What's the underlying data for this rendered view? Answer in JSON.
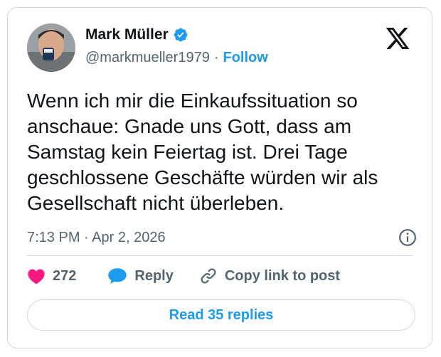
{
  "author": {
    "name": "Mark Müller",
    "handle": "@markmueller1979",
    "separator": "·",
    "follow_label": "Follow",
    "verified": true
  },
  "post": {
    "text": "Wenn ich mir die Einkaufssituation so\nanschaue: Gnade uns Gott, dass am\nSamstag kein Feiertag ist. Drei Tage\ngeschlossene Geschäfte würden wir als\nGesellschaft nicht überleben.",
    "timestamp": "7:13 PM · Apr 2, 2026"
  },
  "actions": {
    "like_count": "272",
    "reply_label": "Reply",
    "copy_label": "Copy link to post"
  },
  "read_replies_label": "Read 35 replies",
  "icons": {
    "brand": "x-logo-icon",
    "verified": "verified-badge-icon",
    "info": "info-icon",
    "like": "heart-icon",
    "reply": "speech-bubble-icon",
    "copy": "link-icon"
  },
  "colors": {
    "accent": "#1d9bf0",
    "like": "#f91880",
    "text": "#0f1419",
    "muted": "#536471",
    "border": "#cfd9de"
  }
}
